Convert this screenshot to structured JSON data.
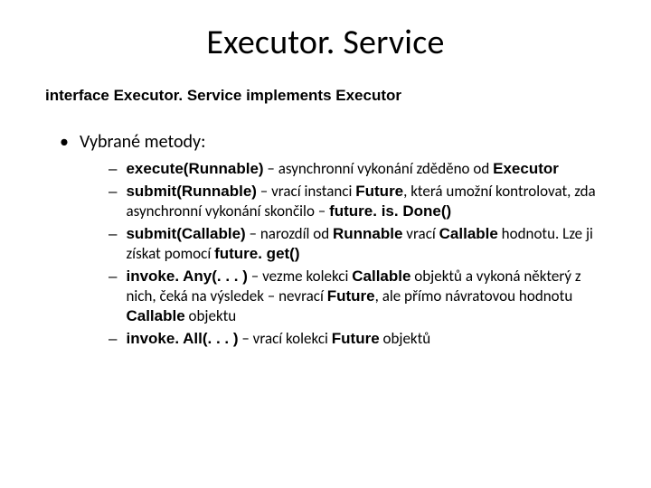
{
  "title": "Executor. Service",
  "subtitle": "interface Executor. Service implements Executor",
  "bullet": "Vybrané metody:",
  "items": [
    {
      "lead": "execute(Runnable)",
      "rest": " – asynchronní vykonání  zděděno od ",
      "tail_b": "Executor"
    },
    {
      "lead": "submit(Runnable)",
      "rest": " – vrací instanci ",
      "mid_b": "Future",
      "rest2": ", která umožní kontrolovat, zda asynchronní vykonání skončilo – ",
      "tail_b": "future. is. Done()"
    },
    {
      "lead": "submit(Callable)",
      "rest": " – narozdíl od ",
      "mid_b": "Runnable",
      "rest2": " vrací ",
      "mid_b2": "Callable",
      "rest3": " hodnotu. Lze ji získat pomocí ",
      "tail_b": "future. get()"
    },
    {
      "lead": "invoke. Any(. . . )",
      "rest": " – vezme kolekci ",
      "mid_b": "Callable",
      "rest2": " objektů a vykoná některý z nich, čeká na výsledek – nevrací ",
      "mid_b2": "Future",
      "rest3": ", ale přímo návratovou hodnotu ",
      "mid_b3": "Callable",
      "rest4": " objektu"
    },
    {
      "lead": "invoke. All(. . . )",
      "rest": " – vrací kolekci ",
      "mid_b": "Future",
      "rest2": " objektů"
    }
  ]
}
